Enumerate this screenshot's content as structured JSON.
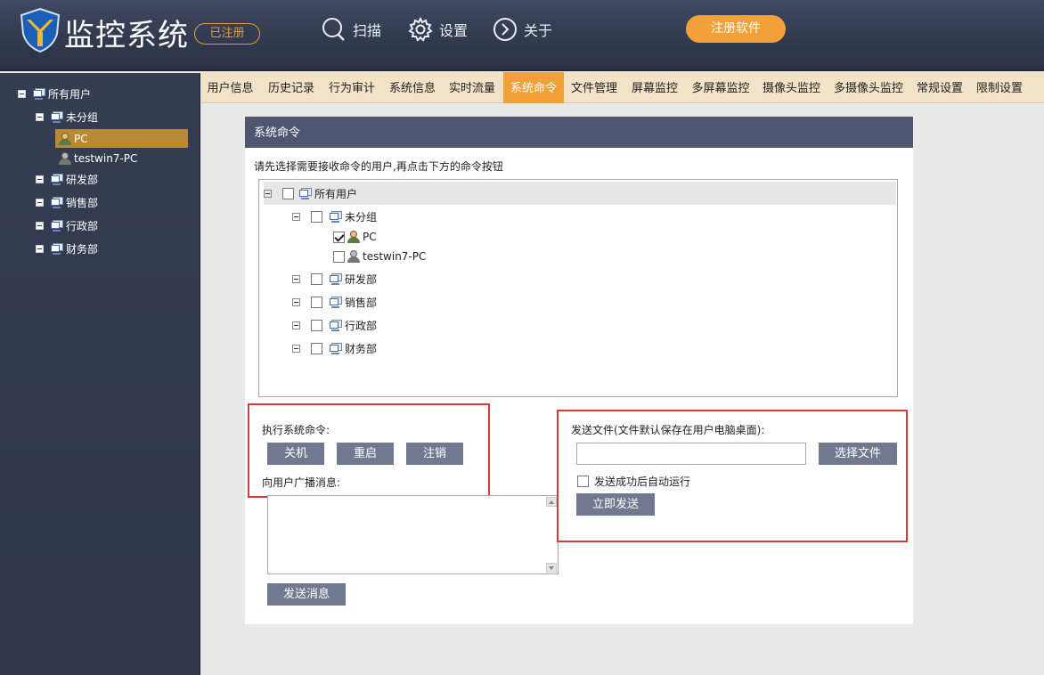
{
  "header": {
    "app_title": "监控系统",
    "registered_badge": "已注册",
    "nav": [
      {
        "label": "扫描",
        "icon": "search-icon"
      },
      {
        "label": "设置",
        "icon": "gear-icon"
      },
      {
        "label": "关于",
        "icon": "chevron-right-circle-icon"
      }
    ],
    "register_button": "注册软件",
    "accent_color": "#f2a03a"
  },
  "sidebar": {
    "root": "所有用户",
    "groups": [
      "未分组",
      "研发部",
      "销售部",
      "行政部",
      "财务部"
    ],
    "users": [
      "PC",
      "testwin7-PC"
    ]
  },
  "tabs": [
    {
      "label": "用户信息"
    },
    {
      "label": "历史记录"
    },
    {
      "label": "行为审计"
    },
    {
      "label": "系统信息"
    },
    {
      "label": "实时流量"
    },
    {
      "label": "系统命令",
      "active": true
    },
    {
      "label": "文件管理"
    },
    {
      "label": "屏幕监控"
    },
    {
      "label": "多屏幕监控"
    },
    {
      "label": "摄像头监控"
    },
    {
      "label": "多摄像头监控"
    },
    {
      "label": "常规设置"
    },
    {
      "label": "限制设置"
    }
  ],
  "panel": {
    "title": "系统命令",
    "instruction": "请先选择需要接收命令的用户,再点击下方的命令按钮",
    "tree": {
      "root": "所有用户",
      "groups": [
        "未分组",
        "研发部",
        "销售部",
        "行政部",
        "财务部"
      ],
      "users": [
        {
          "name": "PC",
          "checked": true
        },
        {
          "name": "testwin7-PC",
          "checked": false
        }
      ]
    },
    "exec": {
      "label": "执行系统命令:",
      "buttons": [
        "关机",
        "重启",
        "注销"
      ]
    },
    "broadcast": {
      "label": "向用户广播消息:",
      "value": "",
      "send_button": "发送消息"
    },
    "file": {
      "label": "发送文件(文件默认保存在用户电脑桌面):",
      "path_value": "",
      "choose_button": "选择文件",
      "autorun_label": "发送成功后自动运行",
      "autorun_checked": false,
      "send_now_button": "立即发送"
    }
  }
}
